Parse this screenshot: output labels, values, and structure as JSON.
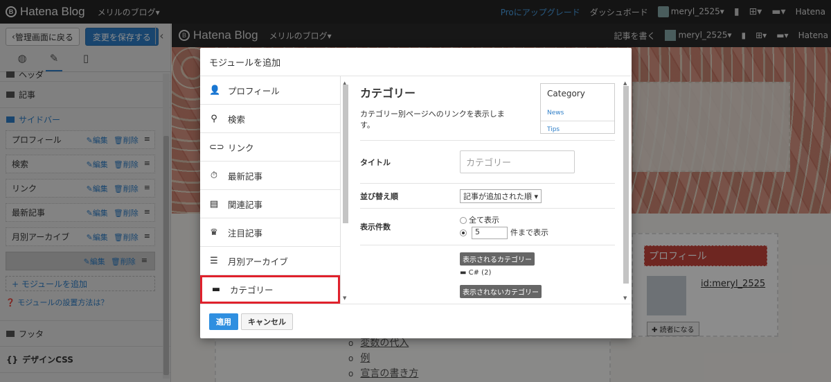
{
  "topbar": {
    "logo": "Hatena Blog",
    "blog_name": "メリルのブログ▾",
    "pro_upgrade": "Proにアップグレード",
    "dashboard": "ダッシュボード",
    "user": "meryl_2525▾",
    "brand": "Hatena"
  },
  "sidebar": {
    "back_label": "管理画面に戻る",
    "save_label": "変更を保存する",
    "collapse": "‹",
    "header_label": "ヘッダ",
    "article_label": "記事",
    "sidebar_label": "サイドバー",
    "edit_label": "編集",
    "delete_label": "削除",
    "modules": [
      "プロフィール",
      "検索",
      "リンク",
      "最新記事",
      "月別アーカイブ",
      ""
    ],
    "add_module": "+ モジュールを追加",
    "howto": "モジュールの設置方法は？",
    "footer_label": "フッタ",
    "css_label": "デザインCSS"
  },
  "preview": {
    "logo": "Hatena Blog",
    "blog_name": "メリルのブログ▾",
    "write": "記事を書く",
    "user": "meryl_2525▾",
    "brand": "Hatena",
    "profile_title": "プロフィール",
    "profile_id": "id:meryl_2525",
    "reader_button": "読者になる",
    "main_items": [
      "変数の代入",
      "例",
      "宣言の書き方"
    ]
  },
  "modal": {
    "title": "モジュールを追加",
    "items": [
      {
        "label": "プロフィール",
        "icon": "person-icon",
        "glyph": "👤"
      },
      {
        "label": "検索",
        "icon": "search-icon",
        "glyph": "⚲"
      },
      {
        "label": "リンク",
        "icon": "link-icon",
        "glyph": "⊂⊃"
      },
      {
        "label": "最新記事",
        "icon": "stopwatch-icon",
        "glyph": "⏱"
      },
      {
        "label": "関連記事",
        "icon": "document-icon",
        "glyph": "▤"
      },
      {
        "label": "注目記事",
        "icon": "crown-icon",
        "glyph": "♛"
      },
      {
        "label": "月別アーカイブ",
        "icon": "list-icon",
        "glyph": "☰"
      },
      {
        "label": "カテゴリー",
        "icon": "folder-icon",
        "glyph": "▬"
      }
    ],
    "detail": {
      "title": "カテゴリー",
      "description": "カテゴリー別ページへのリンクを表示します。",
      "preview_heading": "Category",
      "preview_items": [
        "News",
        "Tips"
      ],
      "title_label": "タイトル",
      "title_placeholder": "カテゴリー",
      "sort_label": "並び替え順",
      "sort_value": "記事が追加された順 ▾",
      "count_label": "表示件数",
      "show_all": "全て表示",
      "count_value": "5",
      "count_suffix": "件まで表示",
      "shown_tag": "表示されるカテゴリー",
      "shown_item": "C# (2)",
      "hidden_tag": "表示されないカテゴリー"
    },
    "apply_label": "適用",
    "cancel_label": "キャンセル"
  }
}
